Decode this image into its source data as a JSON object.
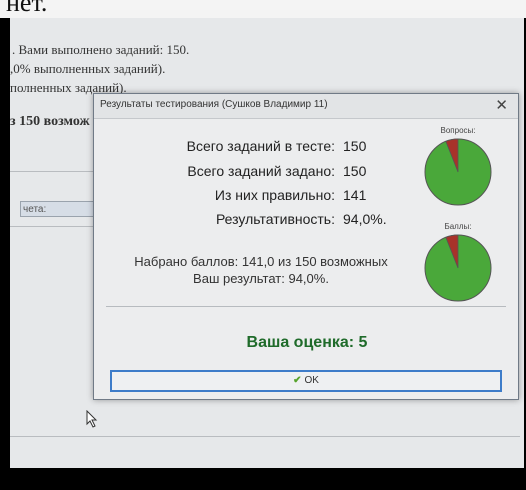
{
  "background": {
    "top_text": "нет.",
    "lines": [
      ". Вами выполнено заданий: 150.",
      ",0% выполненных заданий).",
      "полненных заданий).",
      "з 150 возмож"
    ],
    "input_label": "чета:"
  },
  "dialog": {
    "title": "Результаты тестирования (Сушков Владимир 11)",
    "close_glyph": "✕",
    "stats": [
      {
        "label": "Всего заданий в тесте:",
        "value": "150"
      },
      {
        "label": "Всего заданий задано:",
        "value": "150"
      },
      {
        "label": "Из них правильно:",
        "value": "141"
      },
      {
        "label": "Результативность:",
        "value": "94,0%."
      }
    ],
    "score_line_1": "Набрано баллов: 141,0 из 150 возможных",
    "score_line_2": "Ваш результат: 94,0%.",
    "grade": "Ваша оценка: 5",
    "ok_label": "OK",
    "ok_icon": "check-icon"
  },
  "pies": [
    {
      "label": "Вопросы:",
      "correct_fraction": 0.94,
      "correct_color": "#4aa83a",
      "wrong_color": "#a8322a"
    },
    {
      "label": "Баллы:",
      "correct_fraction": 0.94,
      "correct_color": "#4aa83a",
      "wrong_color": "#a8322a"
    }
  ]
}
